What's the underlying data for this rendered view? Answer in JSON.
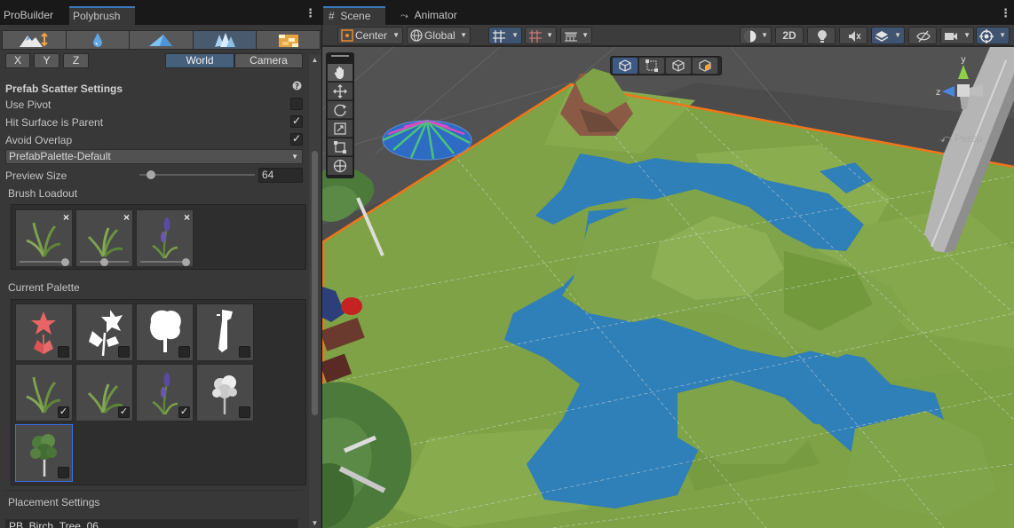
{
  "left_tabs": [
    "ProBuilder",
    "Polybrush"
  ],
  "right_tabs": [
    "Scene",
    "Animator"
  ],
  "brush_modes": [
    {
      "name": "sculpt-icon"
    },
    {
      "name": "smooth-icon"
    },
    {
      "name": "paint-vertex-icon"
    },
    {
      "name": "scatter-prefab-icon"
    },
    {
      "name": "texture-icon"
    }
  ],
  "axis_buttons": [
    "X",
    "Y",
    "Z"
  ],
  "space_buttons": [
    "World",
    "Camera"
  ],
  "prefab_scatter": {
    "title": "Prefab Scatter Settings",
    "use_pivot": {
      "label": "Use Pivot",
      "checked": false
    },
    "hit_surface_is_parent": {
      "label": "Hit Surface is Parent",
      "checked": true
    },
    "avoid_overlap": {
      "label": "Avoid Overlap",
      "checked": true
    },
    "palette": "PrefabPalette-Default",
    "preview_size_label": "Preview Size",
    "preview_size": "64",
    "preview_size_level": 0.12
  },
  "brush_loadout_label": "Brush Loadout",
  "current_palette_label": "Current Palette",
  "palette_items": [
    {
      "icon": "flower-red-icon",
      "checked": false
    },
    {
      "icon": "flower-white-icon",
      "checked": false
    },
    {
      "icon": "bush-white-icon",
      "checked": false
    },
    {
      "icon": "stump-white-icon",
      "checked": false
    },
    {
      "icon": "grass-icon",
      "checked": true
    },
    {
      "icon": "grass-icon",
      "checked": true
    },
    {
      "icon": "lavender-icon",
      "checked": true
    },
    {
      "icon": "tree-grey-icon",
      "checked": false
    },
    {
      "icon": "birch-tree-icon",
      "checked": false
    }
  ],
  "placement_label": "Placement Settings",
  "placement_prefab": "PB_Birch_Tree_06",
  "toolbar": {
    "pivot_mode": "Center",
    "pivot_rotation": "Global",
    "view_2d": "2D"
  },
  "scene": {
    "persp_label": "Persp",
    "gizmo_axes": {
      "y": "y",
      "z": "z"
    }
  },
  "colors": {
    "accent": "#3a79bb",
    "grass": "#7ea245",
    "water": "#2f7fb8",
    "selection_outline": "#f0751a"
  }
}
